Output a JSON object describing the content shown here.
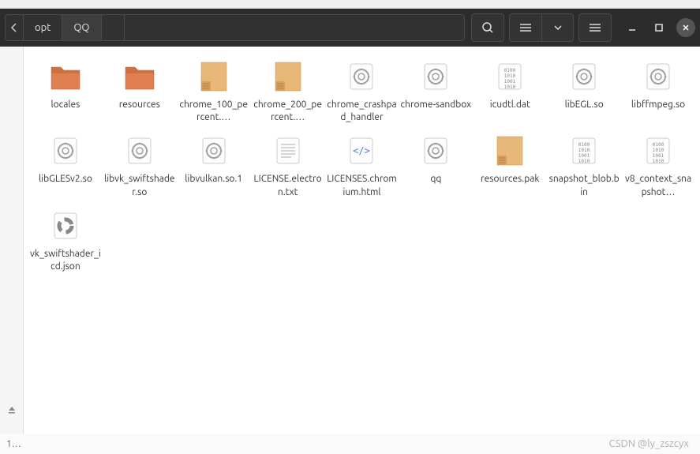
{
  "breadcrumb": {
    "items": [
      "opt",
      "QQ"
    ]
  },
  "files": [
    {
      "name": "locales",
      "type": "folder"
    },
    {
      "name": "resources",
      "type": "folder"
    },
    {
      "name": "chrome_100_percent.…",
      "type": "package"
    },
    {
      "name": "chrome_200_percent.…",
      "type": "package"
    },
    {
      "name": "chrome_crashpad_handler",
      "type": "executable"
    },
    {
      "name": "chrome-sandbox",
      "type": "executable"
    },
    {
      "name": "icudtl.dat",
      "type": "binary"
    },
    {
      "name": "libEGL.so",
      "type": "executable"
    },
    {
      "name": "libffmpeg.so",
      "type": "executable"
    },
    {
      "name": "libGLESv2.so",
      "type": "executable"
    },
    {
      "name": "libvk_swiftshader.so",
      "type": "executable"
    },
    {
      "name": "libvulkan.so.1",
      "type": "executable"
    },
    {
      "name": "LICENSE.electron.txt",
      "type": "text"
    },
    {
      "name": "LICENSES.chromium.html",
      "type": "html"
    },
    {
      "name": "qq",
      "type": "executable"
    },
    {
      "name": "resources.pak",
      "type": "package"
    },
    {
      "name": "snapshot_blob.bin",
      "type": "binary"
    },
    {
      "name": "v8_context_snapshot…",
      "type": "binary"
    },
    {
      "name": "vk_swiftshader_icd.json",
      "type": "json"
    }
  ],
  "status": "1…",
  "watermark": "CSDN @ly_zszcyx"
}
